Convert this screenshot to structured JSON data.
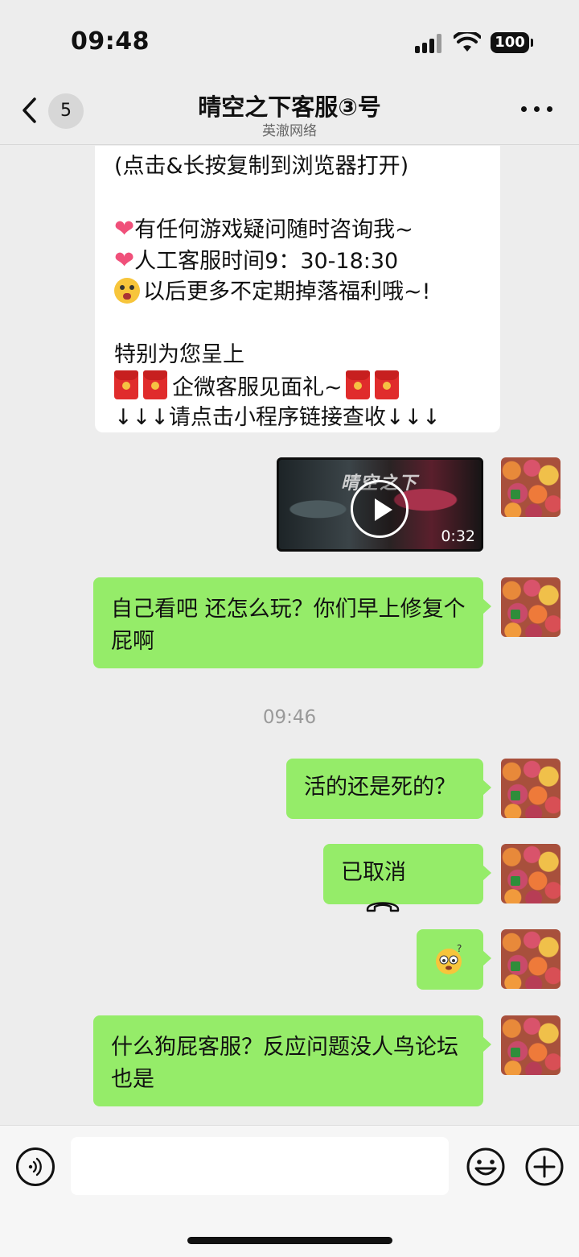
{
  "status_bar": {
    "time": "09:48",
    "battery": "100"
  },
  "nav": {
    "unread_count": "5",
    "title": "晴空之下客服③号",
    "subtitle": "英澈网络"
  },
  "incoming_card": {
    "line_link_hint": "(点击&长按复制到浏览器打开)",
    "line_1": "有任何游戏疑问随时咨询我~",
    "line_2": "人工客服时间9：30-18:30",
    "line_3": "以后更多不定期掉落福利哦~!",
    "line_4": "特别为您呈上",
    "line_5": "企微客服见面礼~",
    "line_6": "↓↓↓请点击小程序链接查收↓↓↓"
  },
  "video": {
    "duration": "0:32",
    "logo_text": "晴空之下"
  },
  "messages": [
    {
      "text": "自己看吧 还怎么玩？你们早上修复个屁啊"
    },
    {
      "text": "活的还是死的？"
    },
    {
      "text": "已取消",
      "icon": "hang-up-phone-icon"
    },
    {
      "text": "",
      "icon": "confused-emoji-sticker"
    },
    {
      "text": "什么狗屁客服？反应问题没人鸟论坛也是"
    }
  ],
  "timestamp": "09:46",
  "input": {
    "placeholder": ""
  }
}
